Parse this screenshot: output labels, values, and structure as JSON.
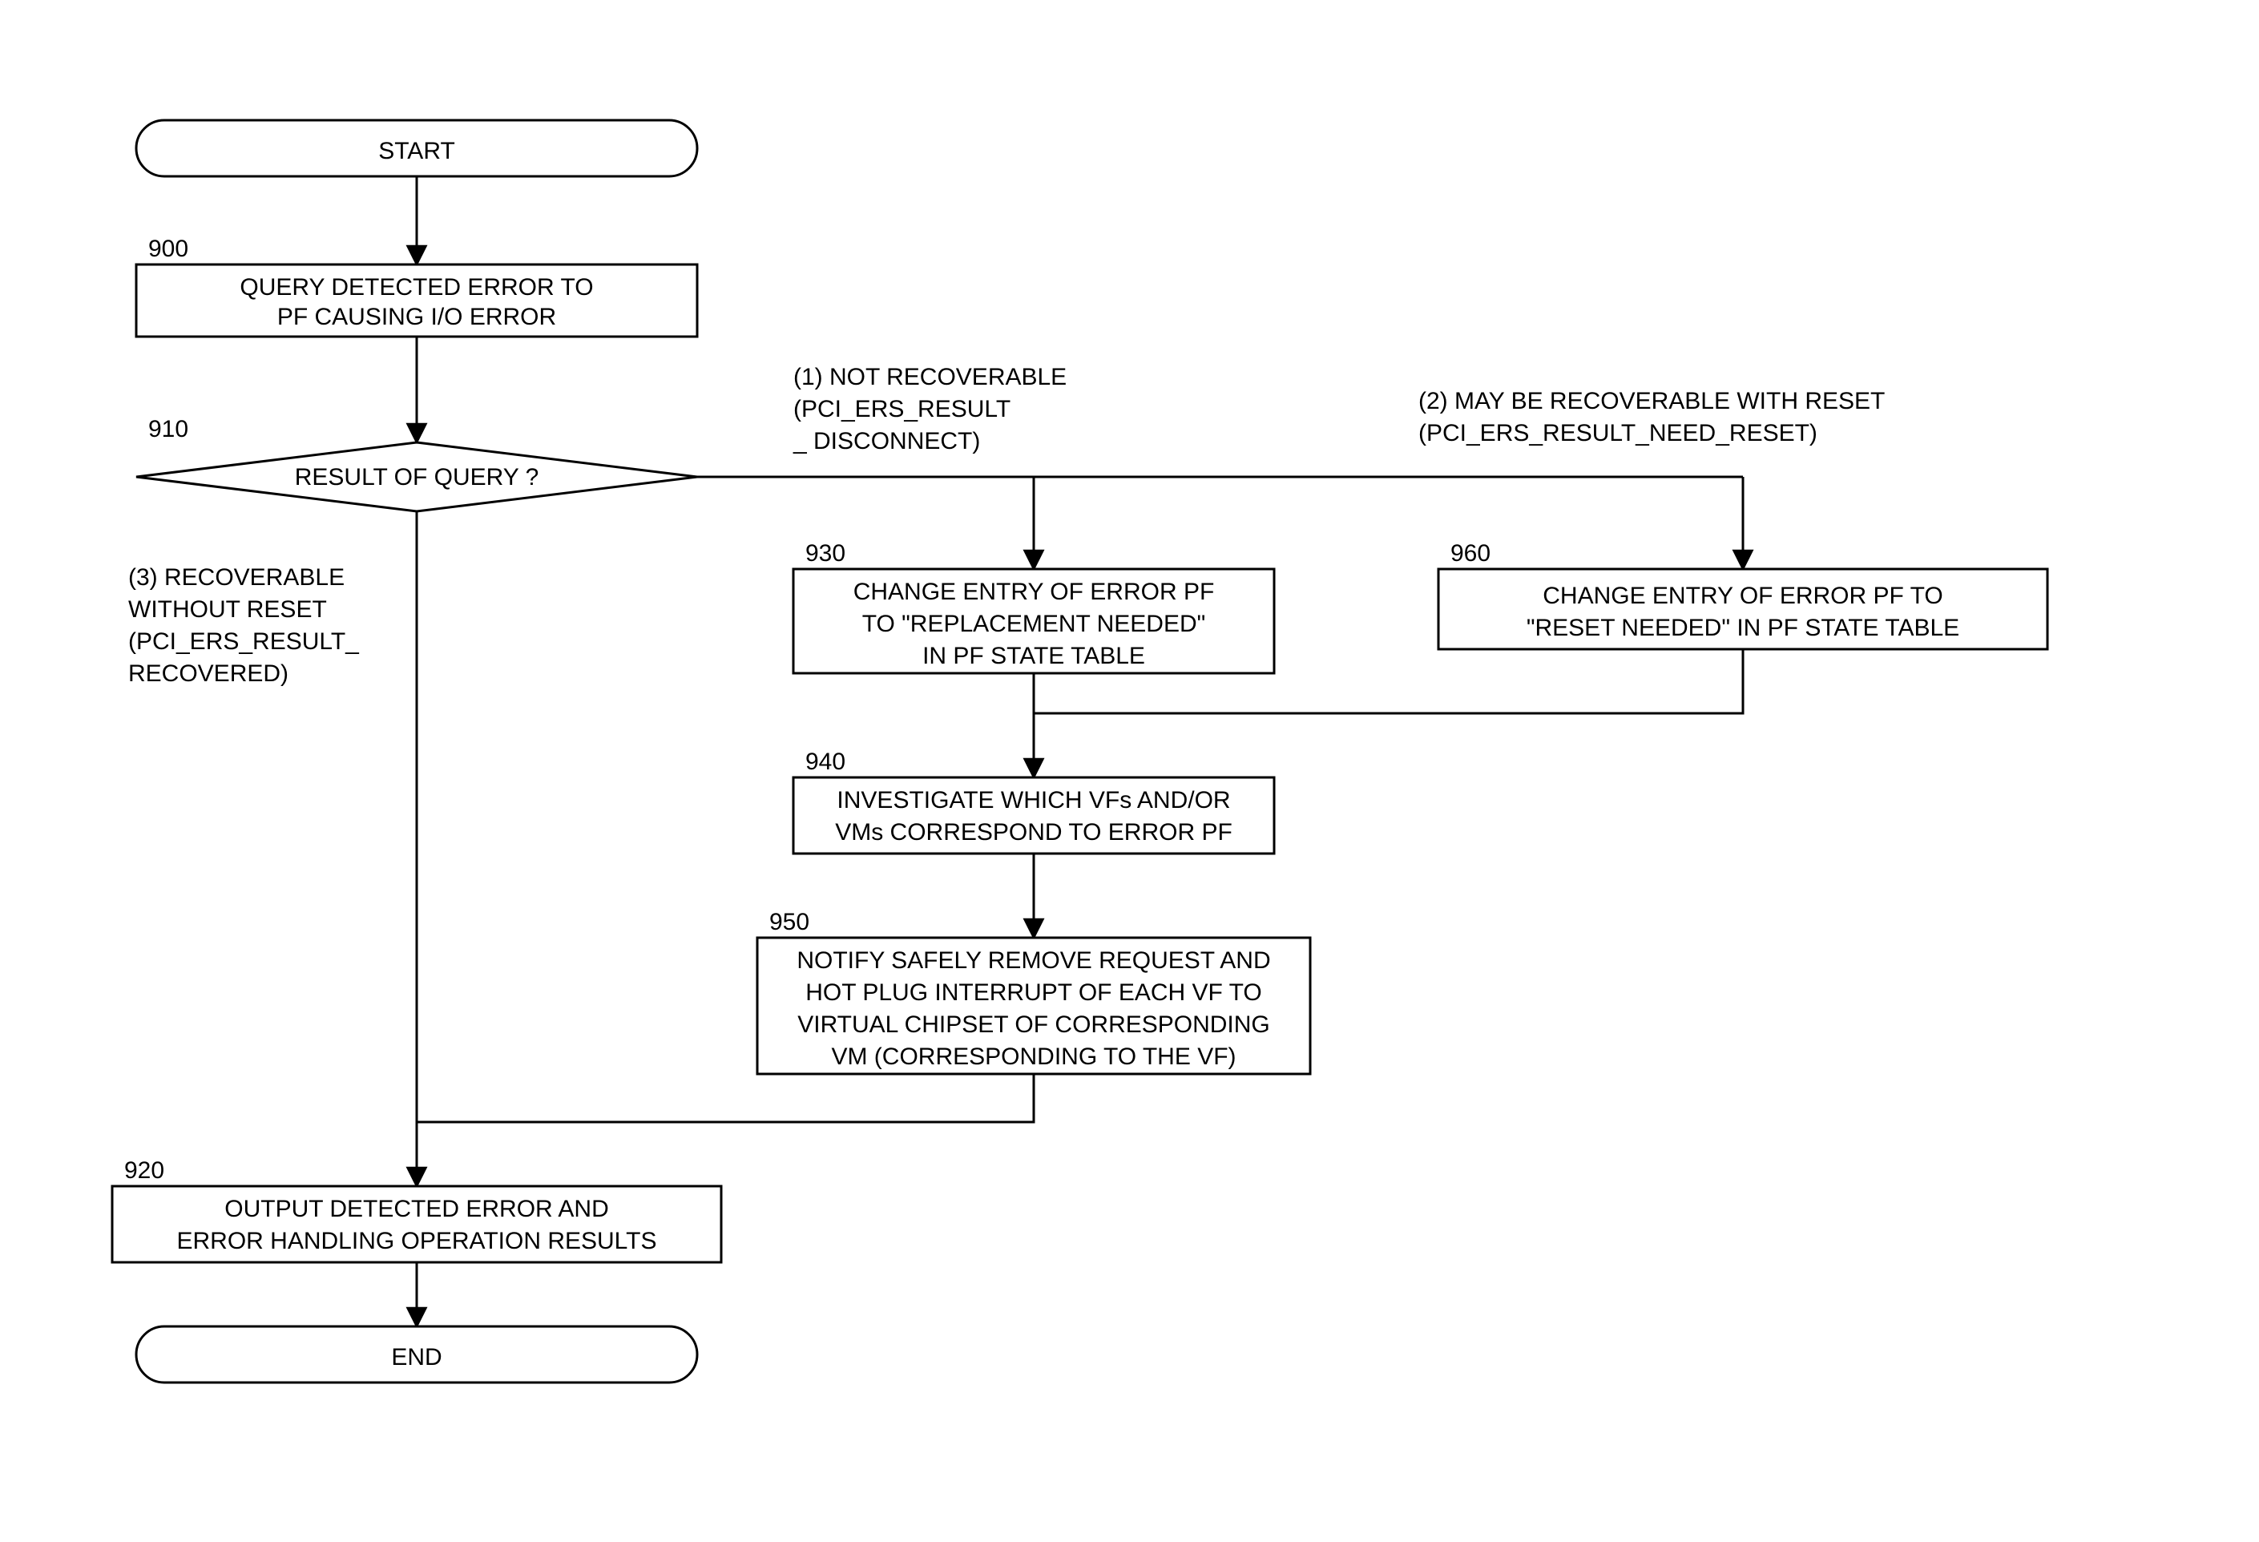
{
  "nodes": {
    "start": "START",
    "n900_num": "900",
    "n900_l1": "QUERY DETECTED ERROR TO",
    "n900_l2": "PF CAUSING I/O ERROR",
    "n910_num": "910",
    "n910": "RESULT OF QUERY ?",
    "n920_num": "920",
    "n920_l1": "OUTPUT DETECTED ERROR AND",
    "n920_l2": "ERROR HANDLING OPERATION RESULTS",
    "n930_num": "930",
    "n930_l1": "CHANGE ENTRY OF ERROR PF",
    "n930_l2": "TO \"REPLACEMENT NEEDED\"",
    "n930_l3": "IN PF STATE TABLE",
    "n940_num": "940",
    "n940_l1": "INVESTIGATE WHICH VFs AND/OR",
    "n940_l2": "VMs CORRESPOND TO ERROR PF",
    "n950_num": "950",
    "n950_l1": "NOTIFY SAFELY REMOVE REQUEST AND",
    "n950_l2": "HOT PLUG INTERRUPT OF EACH VF TO",
    "n950_l3": "VIRTUAL CHIPSET OF CORRESPONDING",
    "n950_l4": "VM (CORRESPONDING TO THE VF)",
    "n960_num": "960",
    "n960_l1": "CHANGE ENTRY OF ERROR PF TO",
    "n960_l2": "\"RESET NEEDED\" IN PF STATE TABLE",
    "end": "END"
  },
  "branches": {
    "b1_l1": "(1)  NOT RECOVERABLE",
    "b1_l2": "(PCI_ERS_RESULT",
    "b1_l3": "_ DISCONNECT)",
    "b2_l1": "(2) MAY BE RECOVERABLE WITH RESET",
    "b2_l2": "(PCI_ERS_RESULT_NEED_RESET)",
    "b3_l1": "(3) RECOVERABLE",
    "b3_l2": "WITHOUT RESET",
    "b3_l3": "(PCI_ERS_RESULT_",
    "b3_l4": "RECOVERED)"
  }
}
